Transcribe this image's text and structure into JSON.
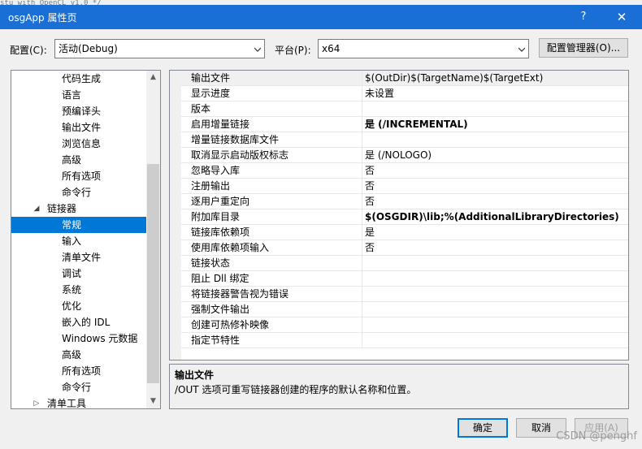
{
  "background_code": "stu with OpenCL v1.0 */",
  "window": {
    "title": "osgApp 属性页",
    "help": "?",
    "close": "✕"
  },
  "config": {
    "label": "配置(C):",
    "value": "活动(Debug)"
  },
  "platform": {
    "label": "平台(P):",
    "value": "x64"
  },
  "config_manager_button": "配置管理器(O)...",
  "tree": {
    "items": [
      {
        "label": "代码生成"
      },
      {
        "label": "语言"
      },
      {
        "label": "预编译头"
      },
      {
        "label": "输出文件"
      },
      {
        "label": "浏览信息"
      },
      {
        "label": "高级"
      },
      {
        "label": "所有选项"
      },
      {
        "label": "命令行"
      },
      {
        "label": "链接器"
      },
      {
        "label": "常规"
      },
      {
        "label": "输入"
      },
      {
        "label": "清单文件"
      },
      {
        "label": "调试"
      },
      {
        "label": "系统"
      },
      {
        "label": "优化"
      },
      {
        "label": "嵌入的 IDL"
      },
      {
        "label": "Windows 元数据"
      },
      {
        "label": "高级"
      },
      {
        "label": "所有选项"
      },
      {
        "label": "命令行"
      },
      {
        "label": "清单工具"
      }
    ]
  },
  "properties": {
    "rows": [
      {
        "name": "输出文件",
        "value": "$(OutDir)$(TargetName)$(TargetExt)"
      },
      {
        "name": "显示进度",
        "value": "未设置"
      },
      {
        "name": "版本",
        "value": ""
      },
      {
        "name": "启用增量链接",
        "value": "是 (/INCREMENTAL)"
      },
      {
        "name": "增量链接数据库文件",
        "value": ""
      },
      {
        "name": "取消显示启动版权标志",
        "value": "是 (/NOLOGO)"
      },
      {
        "name": "忽略导入库",
        "value": "否"
      },
      {
        "name": "注册输出",
        "value": "否"
      },
      {
        "name": "逐用户重定向",
        "value": "否"
      },
      {
        "name": "附加库目录",
        "value": "$(OSGDIR)\\lib;%(AdditionalLibraryDirectories)"
      },
      {
        "name": "链接库依赖项",
        "value": "是"
      },
      {
        "name": "使用库依赖项输入",
        "value": "否"
      },
      {
        "name": "链接状态",
        "value": ""
      },
      {
        "name": "阻止 Dll 绑定",
        "value": ""
      },
      {
        "name": "将链接器警告视为错误",
        "value": ""
      },
      {
        "name": "强制文件输出",
        "value": ""
      },
      {
        "name": "创建可热修补映像",
        "value": ""
      },
      {
        "name": "指定节特性",
        "value": ""
      }
    ]
  },
  "description": {
    "title": "输出文件",
    "text": "/OUT 选项可重写链接器创建的程序的默认名称和位置。"
  },
  "buttons": {
    "ok": "确定",
    "cancel": "取消",
    "apply": "应用(A)"
  },
  "watermark": "CSDN @penghf",
  "colors": {
    "accent": "#0078d7",
    "titlebar": "#1a6fd6"
  }
}
